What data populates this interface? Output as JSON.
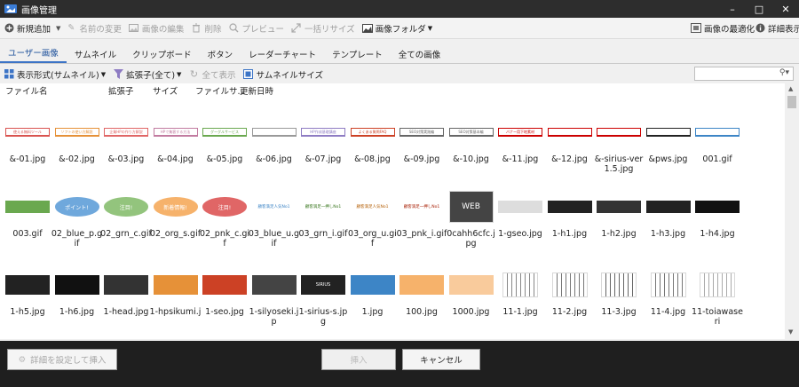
{
  "window": {
    "title": "画像管理"
  },
  "toolbar": {
    "new_label": "新規追加",
    "rename_label": "名前の変更",
    "edit_label": "画像の編集",
    "delete_label": "削除",
    "preview_label": "プレビュー",
    "batch_resize_label": "一括リサイズ",
    "folder_label": "画像フォルダ",
    "optimize_label": "画像の最適化",
    "details_label": "詳細表示"
  },
  "tabs": [
    "ユーザー画像",
    "サムネイル",
    "クリップボード",
    "ボタン",
    "レーダーチャート",
    "テンプレート",
    "全ての画像"
  ],
  "subbar": {
    "view_mode_label": "表示形式(サムネイル)",
    "ext_filter_label": "拡張子(全て)",
    "show_all_label": "全て表示",
    "thumb_size_label": "サムネイルサイズ"
  },
  "search": {
    "placeholder": ""
  },
  "columns": [
    "ファイル名",
    "拡張子",
    "サイズ",
    "ファイルサ...",
    "更新日時"
  ],
  "files_row1": [
    {
      "name": "&-01.jpg",
      "thumb": "使える無料ツール",
      "color": "#d9534f"
    },
    {
      "name": "&-02.jpg",
      "thumb": "ソフトの使い方解説",
      "color": "#e69138"
    },
    {
      "name": "&-03.jpg",
      "thumb": "企業HPの作り方解説",
      "color": "#e06666"
    },
    {
      "name": "&-04.jpg",
      "thumb": "HPで集客する方法",
      "color": "#c27ba0"
    },
    {
      "name": "&-05.jpg",
      "thumb": "グーグルサービス",
      "color": "#6aa84f"
    },
    {
      "name": "&-06.jpg",
      "thumb": "",
      "color": "#999999"
    },
    {
      "name": "&-07.jpg",
      "thumb": "HP作成基礎講座",
      "color": "#8e7cc3"
    },
    {
      "name": "&-08.jpg",
      "thumb": "よくある質問FAQ",
      "color": "#cc4125"
    },
    {
      "name": "&-09.jpg",
      "thumb": "SEO対策実践編",
      "color": "#666666"
    },
    {
      "name": "&-10.jpg",
      "thumb": "SEO対策基本編",
      "color": "#666666"
    },
    {
      "name": "&-11.jpg",
      "thumb": "バナー用下地素材",
      "color": "#cc0000"
    },
    {
      "name": "&-12.jpg",
      "thumb": "",
      "color": "#cc0000"
    },
    {
      "name": "&-sirius-ver1.5.jpg",
      "thumb": "",
      "color": "#cc0000"
    },
    {
      "name": "&pws.jpg",
      "thumb": "",
      "color": "#222222"
    },
    {
      "name": "001.gif",
      "thumb": "",
      "color": "#3d85c6"
    }
  ],
  "files_row2": [
    {
      "name": "003.gif",
      "thumb": "",
      "color": "#6aa84f"
    },
    {
      "name": "02_blue_p.gif",
      "thumb": "ポイント!",
      "color": "#6fa8dc"
    },
    {
      "name": "02_grn_c.gif",
      "thumb": "注目!",
      "color": "#93c47d"
    },
    {
      "name": "02_org_s.gif",
      "thumb": "新着情報!",
      "color": "#f6b26b"
    },
    {
      "name": "02_pnk_c.gif",
      "thumb": "注目!",
      "color": "#e06666"
    },
    {
      "name": "03_blue_u.gif",
      "thumb": "顧客満足人気No1",
      "color": "#3d85c6"
    },
    {
      "name": "03_grn_i.gif",
      "thumb": "顧客満足一押しNo1",
      "color": "#38761d"
    },
    {
      "name": "03_org_u.gif",
      "thumb": "顧客満足人気No1",
      "color": "#b45f06"
    },
    {
      "name": "03_pnk_i.gif",
      "thumb": "顧客満足一押しNo1",
      "color": "#a61c00"
    },
    {
      "name": "0cahh6cfc.jpg",
      "thumb": "WEB",
      "color": "#444444"
    },
    {
      "name": "1-gseo.jpg",
      "thumb": "",
      "color": "#dddddd"
    },
    {
      "name": "1-h1.jpg",
      "thumb": "",
      "color": "#222222"
    },
    {
      "name": "1-h2.jpg",
      "thumb": "",
      "color": "#333333"
    },
    {
      "name": "1-h3.jpg",
      "thumb": "",
      "color": "#222222"
    },
    {
      "name": "1-h4.jpg",
      "thumb": "",
      "color": "#111111"
    }
  ],
  "files_row3": [
    {
      "name": "1-h5.jpg",
      "thumb": "",
      "color": "#222222"
    },
    {
      "name": "1-h6.jpg",
      "thumb": "",
      "color": "#111111"
    },
    {
      "name": "1-head.jpg",
      "thumb": "",
      "color": "#333333"
    },
    {
      "name": "1-hpsikumi.j",
      "thumb": "",
      "color": "#e69138"
    },
    {
      "name": "1-seo.jpg",
      "thumb": "",
      "color": "#cc4125"
    },
    {
      "name": "1-silyoseki.jp",
      "thumb": "",
      "color": "#444444"
    },
    {
      "name": "1-sirius-s.jpg",
      "thumb": "SIRIUS",
      "color": "#222222"
    },
    {
      "name": "1.jpg",
      "thumb": "",
      "color": "#3d85c6"
    },
    {
      "name": "100.jpg",
      "thumb": "",
      "color": "#f6b26b"
    },
    {
      "name": "1000.jpg",
      "thumb": "",
      "color": "#f9cb9c"
    },
    {
      "name": "11-1.jpg",
      "thumb": "",
      "color": "#888888"
    },
    {
      "name": "11-2.jpg",
      "thumb": "",
      "color": "#777777"
    },
    {
      "name": "11-3.jpg",
      "thumb": "",
      "color": "#666666"
    },
    {
      "name": "11-4.jpg",
      "thumb": "",
      "color": "#777777"
    },
    {
      "name": "11-toiawaseri",
      "thumb": "",
      "color": "#aaaaaa"
    }
  ],
  "bottom": {
    "detail_insert_label": "詳細を設定して挿入",
    "insert_label": "挿入",
    "cancel_label": "キャンセル"
  }
}
